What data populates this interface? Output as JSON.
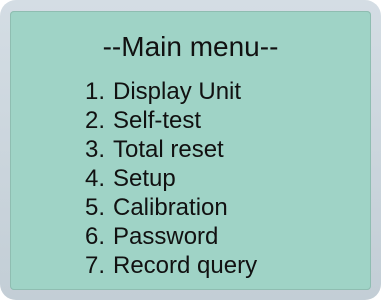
{
  "menu": {
    "title": "--Main menu--",
    "items": [
      {
        "number": "1.",
        "label": "Display Unit"
      },
      {
        "number": "2.",
        "label": "Self-test"
      },
      {
        "number": "3.",
        "label": "Total reset"
      },
      {
        "number": "4.",
        "label": "Setup"
      },
      {
        "number": "5.",
        "label": "Calibration"
      },
      {
        "number": "6.",
        "label": "Password"
      },
      {
        "number": "7.",
        "label": "Record query"
      }
    ]
  },
  "colors": {
    "screen_background": "#9fd3c6",
    "bezel": "#c8d2da",
    "text": "#111111"
  }
}
